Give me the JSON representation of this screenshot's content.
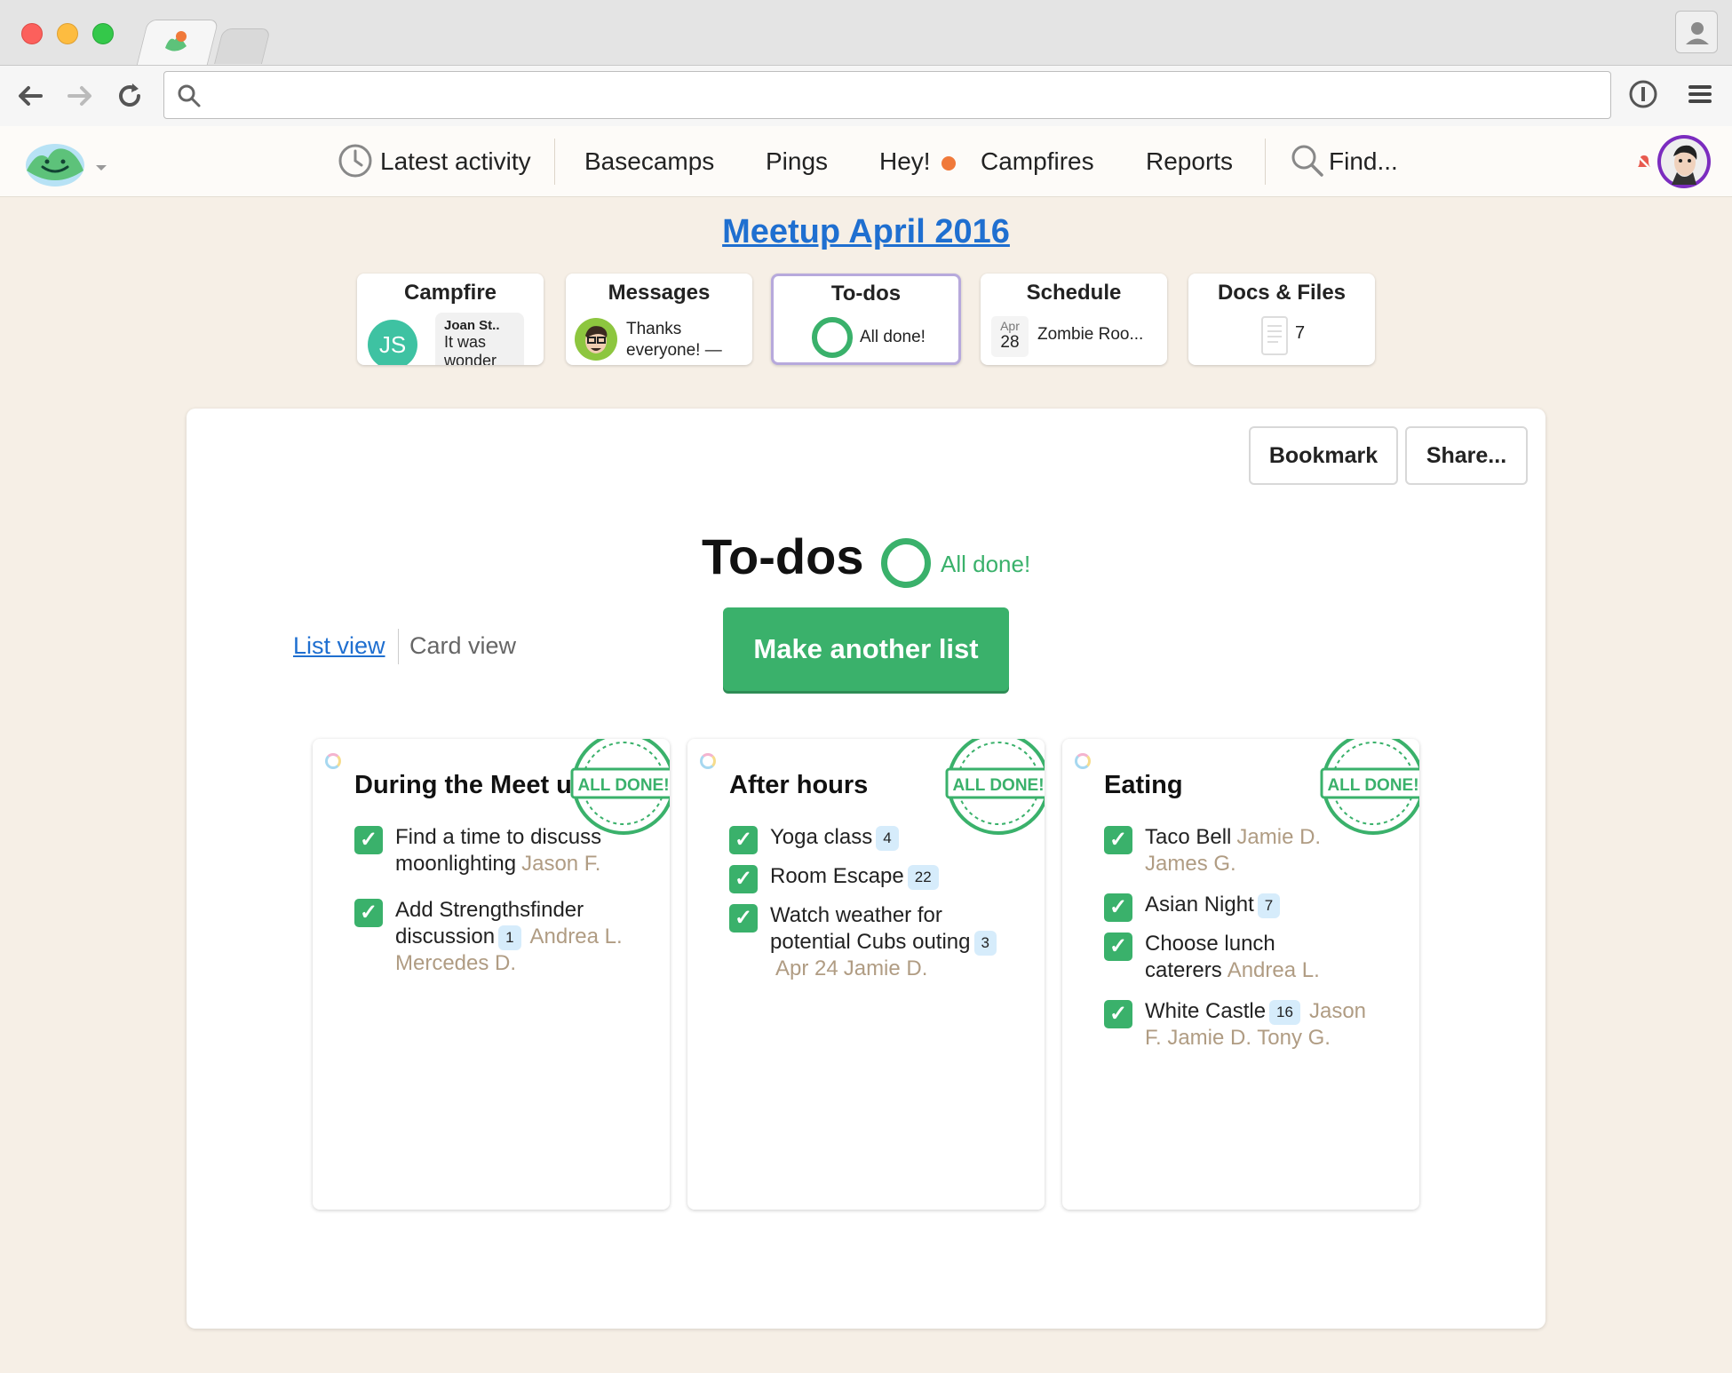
{
  "browser": {
    "back_icon": "arrow-left-icon",
    "forward_icon": "arrow-right-icon",
    "reload_icon": "reload-icon",
    "address": ""
  },
  "nav": {
    "latest_activity": "Latest activity",
    "basecamps": "Basecamps",
    "pings": "Pings",
    "hey": "Hey!",
    "campfires": "Campfires",
    "reports": "Reports",
    "find": "Find..."
  },
  "project": {
    "title": "Meetup April 2016"
  },
  "tools": {
    "campfire": {
      "title": "Campfire",
      "initials": "JS",
      "author": "Joan St..",
      "line1": "It was",
      "line2": "wonder"
    },
    "messages": {
      "title": "Messages",
      "line1": "Thanks",
      "line2": "everyone! —"
    },
    "todos": {
      "title": "To-dos",
      "status": "All done!"
    },
    "schedule": {
      "title": "Schedule",
      "month": "Apr",
      "day": "28",
      "event": "Zombie Roo..."
    },
    "docs": {
      "title": "Docs & Files",
      "count": "7"
    }
  },
  "panel": {
    "bookmark": "Bookmark",
    "share": "Share...",
    "heading": "To-dos",
    "heading_status": "All done!",
    "list_view": "List view",
    "card_view": "Card view",
    "make_list": "Make another list"
  },
  "stamp_text": "ALL DONE!",
  "lists": [
    {
      "title": "During the Meet up",
      "items": [
        {
          "text": "Find a time to discuss moonlighting",
          "count": "",
          "date": "",
          "people": "Jason F."
        },
        {
          "text": "Add Strengthsfinder discussion",
          "count": "1",
          "date": "",
          "people": "Andrea L.  Mercedes D."
        }
      ]
    },
    {
      "title": "After hours",
      "items": [
        {
          "text": "Yoga class",
          "count": "4",
          "date": "",
          "people": ""
        },
        {
          "text": "Room Escape",
          "count": "22",
          "date": "",
          "people": ""
        },
        {
          "text": "Watch weather for potential Cubs outing",
          "count": "3",
          "date": "Apr 24",
          "people": "Jamie D."
        }
      ]
    },
    {
      "title": "Eating",
      "items": [
        {
          "text": "Taco Bell",
          "count": "",
          "date": "",
          "people": "Jamie D.  James G."
        },
        {
          "text": "Asian Night",
          "count": "7",
          "date": "",
          "people": ""
        },
        {
          "text": "Choose lunch caterers",
          "count": "",
          "date": "",
          "people": "Andrea L."
        },
        {
          "text": "White Castle",
          "count": "16",
          "date": "",
          "people": "Jason F.  Jamie D.  Tony G."
        }
      ]
    }
  ]
}
